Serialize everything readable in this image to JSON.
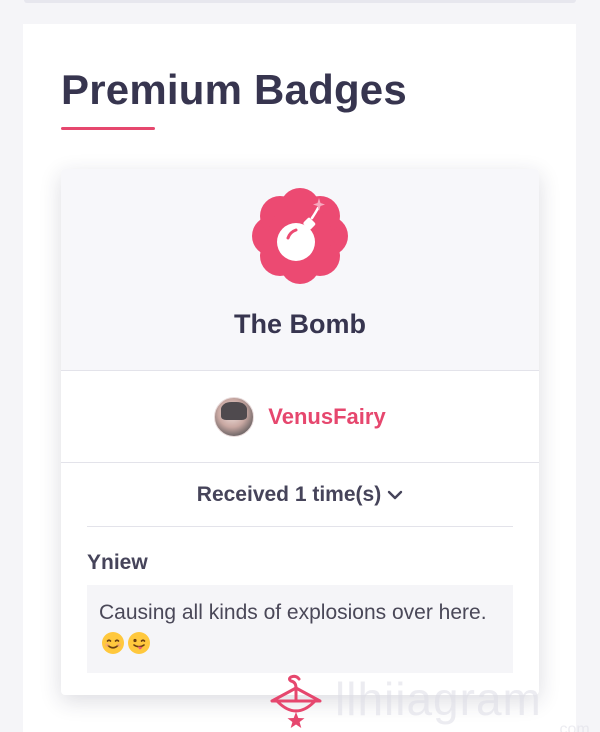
{
  "section": {
    "title": "Premium Badges"
  },
  "badge": {
    "name": "The Bomb",
    "icon": "bomb-icon",
    "accent_color": "#e6476e"
  },
  "giver": {
    "username": "VenusFairy",
    "avatar": "avatar"
  },
  "received": {
    "label": "Received 1 time(s)",
    "expand_icon": "chevron-down-icon"
  },
  "comment": {
    "author": "Yniew",
    "text": "Causing all kinds of explosions over here.",
    "emojis": [
      "smiling-face-emoji",
      "winking-tongue-emoji"
    ]
  },
  "watermark": {
    "text": "llhiiagram",
    "sub": ".com"
  }
}
